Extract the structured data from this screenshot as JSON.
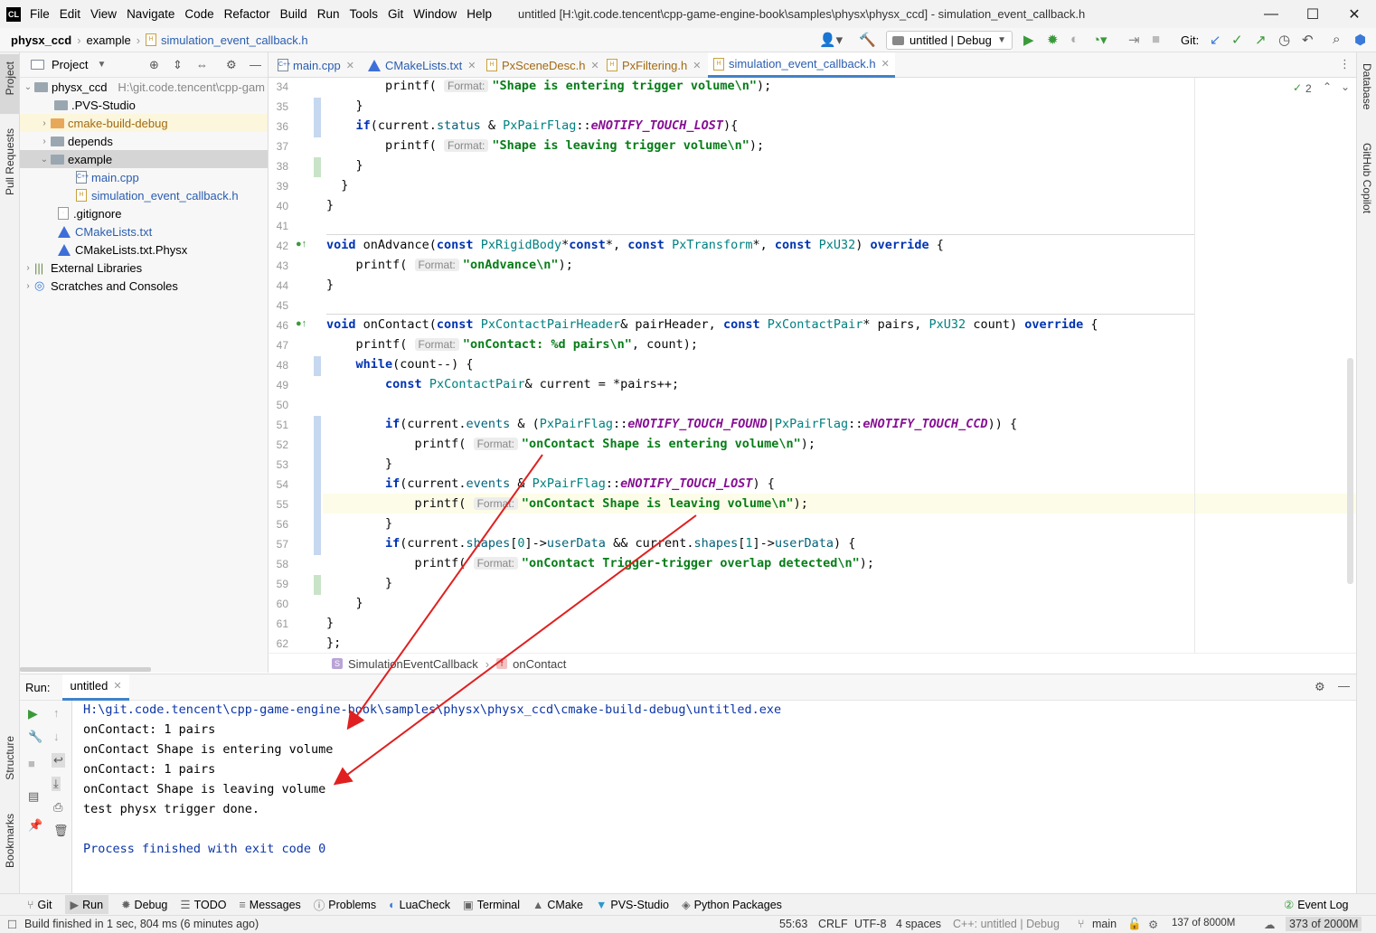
{
  "menubar": {
    "items": [
      "File",
      "Edit",
      "View",
      "Navigate",
      "Code",
      "Refactor",
      "Build",
      "Run",
      "Tools",
      "Git",
      "Window",
      "Help"
    ],
    "title": "untitled [H:\\git.code.tencent\\cpp-game-engine-book\\samples\\physx\\physx_ccd] - simulation_event_callback.h"
  },
  "navbar": {
    "crumbs": [
      "physx_ccd",
      "example",
      "simulation_event_callback.h"
    ],
    "run_config": "untitled | Debug",
    "git_label": "Git:"
  },
  "left_strip": {
    "project": "Project",
    "pull_requests": "Pull Requests",
    "structure": "Structure",
    "bookmarks": "Bookmarks"
  },
  "right_strip": {
    "database": "Database",
    "copilot": "GitHub Copilot"
  },
  "project": {
    "title": "Project",
    "tree": [
      {
        "label": "physx_ccd",
        "extra": "H:\\git.code.tencent\\cpp-gam",
        "type": "folder",
        "depth": 0,
        "open": true
      },
      {
        "label": ".PVS-Studio",
        "type": "folder",
        "depth": 1
      },
      {
        "label": "cmake-build-debug",
        "type": "folder-orange",
        "depth": 1,
        "closed": true
      },
      {
        "label": "depends",
        "type": "folder",
        "depth": 1,
        "closed": true
      },
      {
        "label": "example",
        "type": "folder",
        "depth": 1,
        "open": true
      },
      {
        "label": "main.cpp",
        "type": "cpp",
        "depth": 2
      },
      {
        "label": "simulation_event_callback.h",
        "type": "h",
        "depth": 2
      },
      {
        "label": ".gitignore",
        "type": "txt",
        "depth": 1
      },
      {
        "label": "CMakeLists.txt",
        "type": "cmake",
        "depth": 1
      },
      {
        "label": "CMakeLists.txt.Physx",
        "type": "cmake",
        "depth": 1
      },
      {
        "label": "External Libraries",
        "type": "lib",
        "depth": 0,
        "closed": true
      },
      {
        "label": "Scratches and Consoles",
        "type": "scratch",
        "depth": 0,
        "closed": true
      }
    ]
  },
  "tabs": [
    "main.cpp",
    "CMakeLists.txt",
    "PxSceneDesc.h",
    "PxFiltering.h",
    "simulation_event_callback.h"
  ],
  "editor": {
    "inspections": "2",
    "lines": [
      {
        "n": "34",
        "html": "        printf( <span class='hint'>Format:</span><span class='str'>\"Shape is entering trigger volume\\n\"</span>);"
      },
      {
        "n": "35",
        "html": "    }"
      },
      {
        "n": "36",
        "html": "    <span class='kw'>if</span>(current.<span class='fn'>status</span> &amp; <span class='ty'>PxPairFlag</span>::<span class='en'>eNOTIFY_TOUCH_LOST</span>){"
      },
      {
        "n": "37",
        "html": "        printf( <span class='hint'>Format:</span><span class='str'>\"Shape is leaving trigger volume\\n\"</span>);"
      },
      {
        "n": "38",
        "html": "    }"
      },
      {
        "n": "39",
        "html": "  }"
      },
      {
        "n": "40",
        "html": "}"
      },
      {
        "n": "41",
        "html": ""
      },
      {
        "n": "42",
        "html": "<span class='kw'>void</span> onAdvance(<span class='kw'>const</span> <span class='ty'>PxRigidBody</span>*<span class='kw'>const</span>*, <span class='kw'>const</span> <span class='ty'>PxTransform</span>*, <span class='kw'>const</span> <span class='ty'>PxU32</span>) <span class='kw'>override</span> {"
      },
      {
        "n": "43",
        "html": "    printf( <span class='hint'>Format:</span><span class='str'>\"onAdvance\\n\"</span>);"
      },
      {
        "n": "44",
        "html": "}"
      },
      {
        "n": "45",
        "html": ""
      },
      {
        "n": "46",
        "html": "<span class='kw'>void</span> onContact(<span class='kw'>const</span> <span class='ty'>PxContactPairHeader</span>&amp; pairHeader, <span class='kw'>const</span> <span class='ty'>PxContactPair</span>* pairs, <span class='ty'>PxU32</span> count) <span class='kw'>override</span> {"
      },
      {
        "n": "47",
        "html": "    printf( <span class='hint'>Format:</span><span class='str'>\"onContact: %d pairs\\n\"</span>, count);"
      },
      {
        "n": "48",
        "html": "    <span class='kw'>while</span>(count--) {"
      },
      {
        "n": "49",
        "html": "        <span class='kw'>const</span> <span class='ty'>PxContactPair</span>&amp; current = *pairs++;"
      },
      {
        "n": "50",
        "html": ""
      },
      {
        "n": "51",
        "html": "        <span class='kw'>if</span>(current.<span class='fn'>events</span> &amp; (<span class='ty'>PxPairFlag</span>::<span class='en'>eNOTIFY_TOUCH_FOUND</span>|<span class='ty'>PxPairFlag</span>::<span class='en'>eNOTIFY_TOUCH_CCD</span>)) {"
      },
      {
        "n": "52",
        "html": "            printf( <span class='hint'>Format:</span><span class='str'>\"onContact Shape is entering volume\\n\"</span>);"
      },
      {
        "n": "53",
        "html": "        }"
      },
      {
        "n": "54",
        "html": "        <span class='kw'>if</span>(current.<span class='fn'>events</span> &amp; <span class='ty'>PxPairFlag</span>::<span class='en'>eNOTIFY_TOUCH_LOST</span>) {"
      },
      {
        "n": "55",
        "html": "            printf( <span class='hint'>Format:</span><span class='str'>\"onContact Shape is leaving volume\\n\"</span>);"
      },
      {
        "n": "56",
        "html": "        }"
      },
      {
        "n": "57",
        "html": "        <span class='kw'>if</span>(current.<span class='fn'>shapes</span>[<span class='ty'>0</span>]-&gt;<span class='fn'>userData</span> &amp;&amp; current.<span class='fn'>shapes</span>[<span class='ty'>1</span>]-&gt;<span class='fn'>userData</span>) {"
      },
      {
        "n": "58",
        "html": "            printf( <span class='hint'>Format:</span><span class='str'>\"onContact Trigger-trigger overlap detected\\n\"</span>);"
      },
      {
        "n": "59",
        "html": "        }"
      },
      {
        "n": "60",
        "html": "    }"
      },
      {
        "n": "61",
        "html": "}"
      },
      {
        "n": "62",
        "html": "};"
      }
    ]
  },
  "editor_breadcrumb": [
    "SimulationEventCallback",
    "onContact"
  ],
  "run": {
    "label": "Run:",
    "tab": "untitled",
    "output": [
      {
        "text": "H:\\git.code.tencent\\cpp-game-engine-book\\samples\\physx\\physx_ccd\\cmake-build-debug\\untitled.exe",
        "blue": true
      },
      {
        "text": "onContact: 1 pairs"
      },
      {
        "text": "onContact Shape is entering volume"
      },
      {
        "text": "onContact: 1 pairs"
      },
      {
        "text": "onContact Shape is leaving volume"
      },
      {
        "text": "test physx trigger done."
      },
      {
        "text": ""
      },
      {
        "text": "Process finished with exit code 0",
        "blue": true
      }
    ]
  },
  "bottom_tools": [
    "Git",
    "Run",
    "Debug",
    "TODO",
    "Messages",
    "Problems",
    "LuaCheck",
    "Terminal",
    "CMake",
    "PVS-Studio",
    "Python Packages"
  ],
  "event_log": "Event Log",
  "status": {
    "message": "Build finished in 1 sec, 804 ms (6 minutes ago)",
    "position": "55:63",
    "line_sep": "CRLF",
    "encoding": "UTF-8",
    "indent": "4 spaces",
    "context": "C++: untitled | Debug",
    "branch": "main",
    "memory1": "137 of 8000M",
    "memory2": "373 of 2000M"
  },
  "colors": {
    "accent": "#4083c9",
    "arrow": "#e02020"
  }
}
